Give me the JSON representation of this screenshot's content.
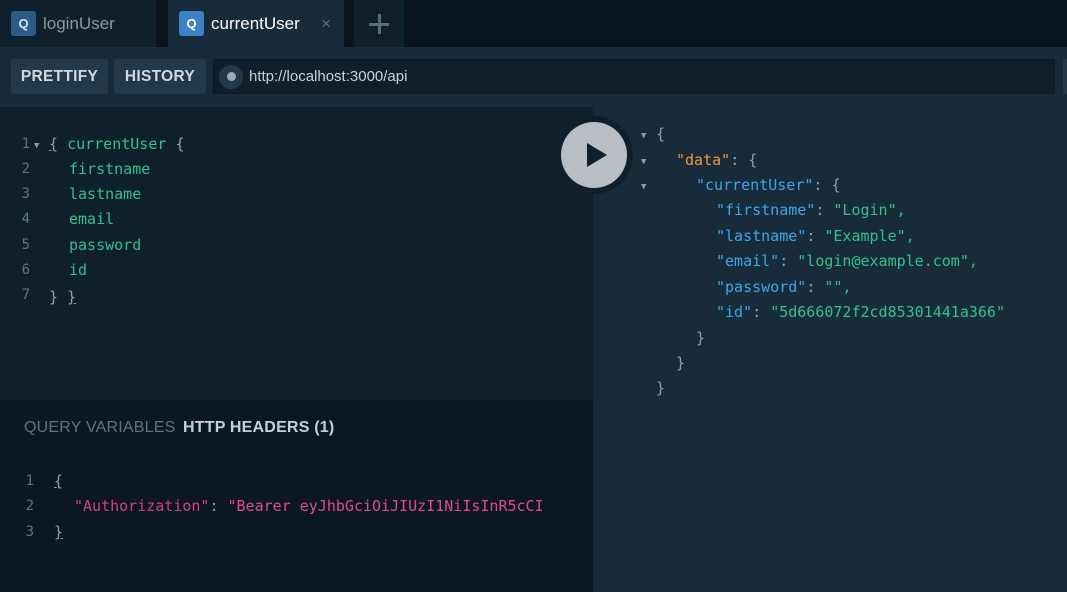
{
  "tabs": [
    {
      "badge": "Q",
      "label": "loginUser"
    },
    {
      "badge": "Q",
      "label": "currentUser",
      "close": "×"
    }
  ],
  "toolbar": {
    "prettify_label": "PRETTIFY",
    "history_label": "HISTORY",
    "url": "http://localhost:3000/api"
  },
  "query": {
    "line_numbers": [
      "1",
      "2",
      "3",
      "4",
      "5",
      "6",
      "7"
    ],
    "lines": [
      "{ currentUser {",
      "firstname",
      "lastname",
      "email",
      "password",
      "id",
      "} }"
    ]
  },
  "result": {
    "open_brace": "{",
    "data_key": "\"data\"",
    "current_user_key": "\"currentUser\"",
    "fields": [
      {
        "key": "\"firstname\"",
        "value": "\"Login\","
      },
      {
        "key": "\"lastname\"",
        "value": "\"Example\","
      },
      {
        "key": "\"email\"",
        "value": "\"login@example.com\","
      },
      {
        "key": "\"password\"",
        "value": "\"\","
      },
      {
        "key": "\"id\"",
        "value": "\"5d666072f2cd85301441a366\""
      }
    ],
    "close_brace": "}"
  },
  "variables": {
    "tab_query_variables": "QUERY VARIABLES",
    "tab_http_headers": "HTTP HEADERS (1)",
    "line_numbers": [
      "1",
      "2",
      "3"
    ],
    "header_key": "\"Authorization\"",
    "header_value": "\"Bearer eyJhbGciOiJIUzI1NiIsInR5cCI"
  },
  "colors": {
    "field": "#34c28a",
    "key": "#3fa6e8",
    "data_key": "#f29a36",
    "header_key": "#d2407d"
  },
  "icons": {
    "tab_badge": "q-badge-icon",
    "close": "close-icon",
    "add_tab": "plus-icon",
    "run": "play-icon",
    "status": "status-dot-icon"
  }
}
